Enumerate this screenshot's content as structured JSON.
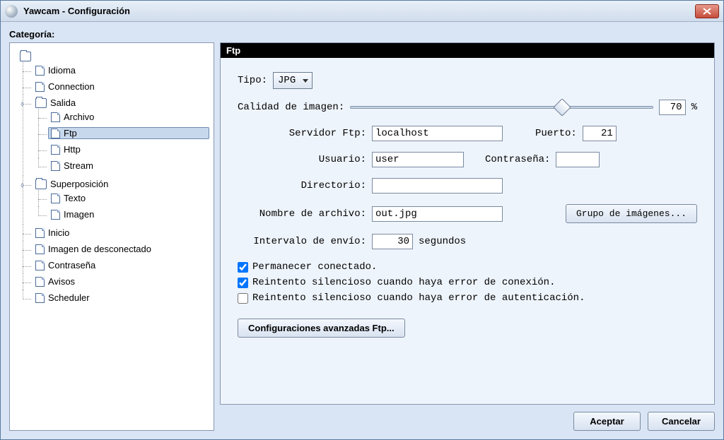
{
  "window": {
    "title": "Yawcam - Configuración"
  },
  "sidebar": {
    "heading": "Categoría:",
    "items": {
      "idioma": "Idioma",
      "connection": "Connection",
      "salida": "Salida",
      "archivo": "Archivo",
      "ftp": "Ftp",
      "http": "Http",
      "stream": "Stream",
      "superposicion": "Superposición",
      "texto": "Texto",
      "imagen": "Imagen",
      "inicio": "Inicio",
      "imagen_desc": "Imagen de desconectado",
      "contrasena": "Contraseña",
      "avisos": "Avisos",
      "scheduler": "Scheduler"
    }
  },
  "panel": {
    "title": "Ftp",
    "tipo_label": "Tipo:",
    "tipo_value": "JPG",
    "calidad_label": "Calidad de imagen:",
    "calidad_value": "70",
    "calidad_suffix": "%",
    "servidor_label": "Servidor Ftp:",
    "servidor_value": "localhost",
    "puerto_label": "Puerto:",
    "puerto_value": "21",
    "usuario_label": "Usuario:",
    "usuario_value": "user",
    "contrasena_label": "Contraseña:",
    "contrasena_value": "",
    "directorio_label": "Directorio:",
    "directorio_value": "",
    "archivo_label": "Nombre de archivo:",
    "archivo_value": "out.jpg",
    "grupo_btn": "Grupo de imágenes...",
    "intervalo_label": "Intervalo de envío:",
    "intervalo_value": "30",
    "intervalo_unit": "segundos",
    "chk_permanecer": "Permanecer conectado.",
    "chk_reintento_conn": "Reintento silencioso cuando haya error de conexión.",
    "chk_reintento_auth": "Reintento silencioso cuando haya error de autenticación.",
    "advanced_btn": "Configuraciones avanzadas Ftp..."
  },
  "footer": {
    "accept": "Aceptar",
    "cancel": "Cancelar"
  }
}
